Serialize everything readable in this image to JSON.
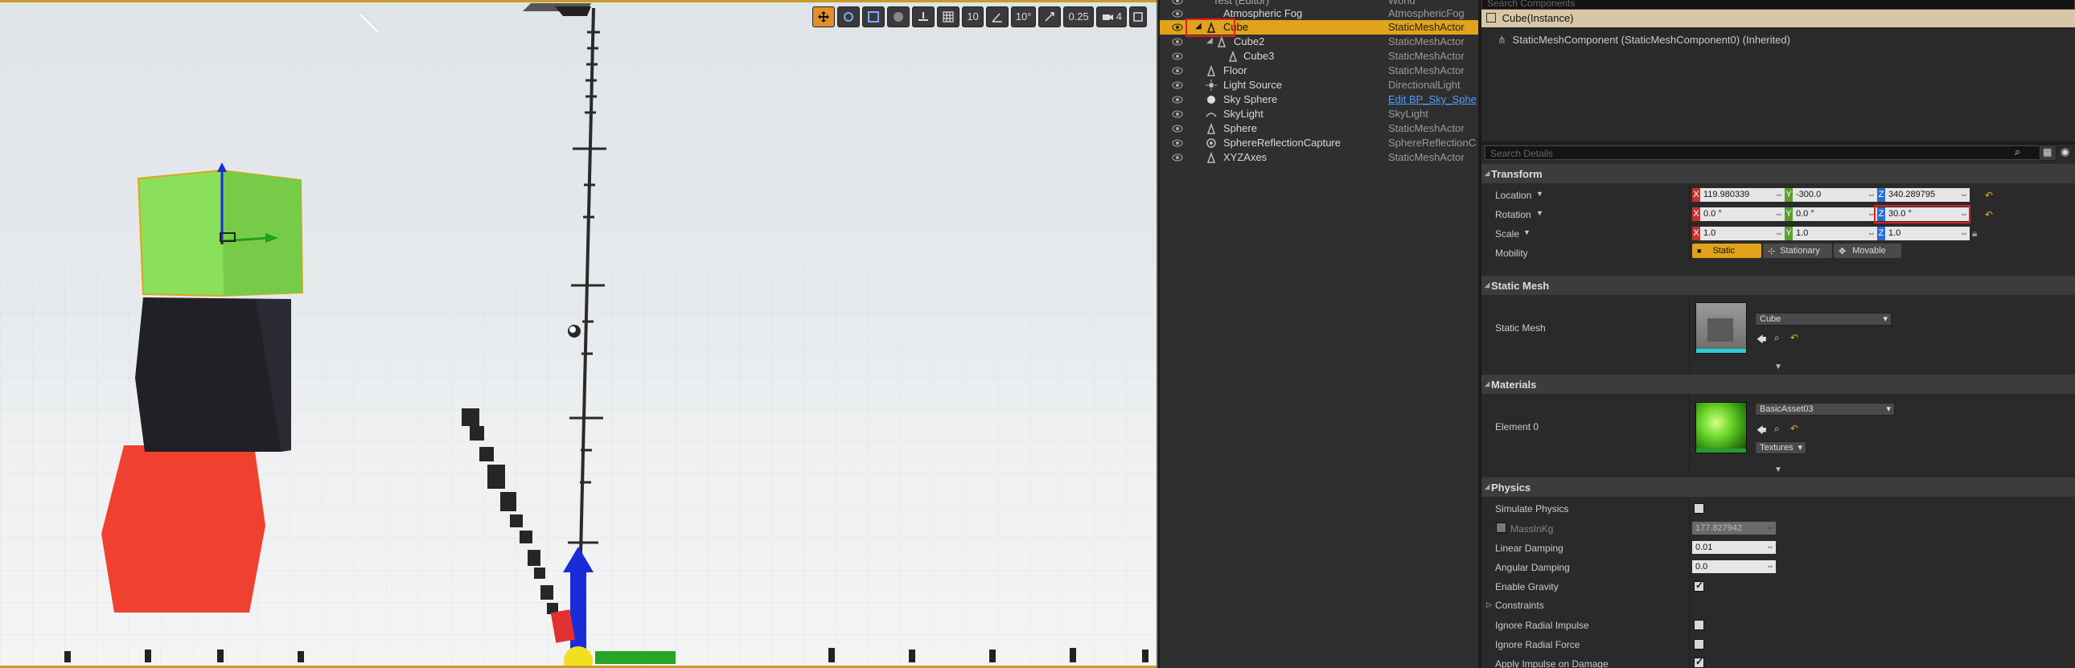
{
  "viewport": {
    "toolbar": {
      "grid_snap": "10",
      "rotation_snap": "10°",
      "scale_snap": "0.25",
      "camera_speed": "4"
    }
  },
  "outliner": {
    "rows": [
      {
        "name": "Test (Editor)",
        "type": "World"
      },
      {
        "name": "Atmospheric Fog",
        "type": "AtmosphericFog"
      },
      {
        "name": "Cube",
        "type": "StaticMeshActor"
      },
      {
        "name": "Cube2",
        "type": "StaticMeshActor"
      },
      {
        "name": "Cube3",
        "type": "StaticMeshActor"
      },
      {
        "name": "Floor",
        "type": "StaticMeshActor"
      },
      {
        "name": "Light Source",
        "type": "DirectionalLight"
      },
      {
        "name": "Sky Sphere",
        "type": "Edit BP_Sky_Sphere"
      },
      {
        "name": "SkyLight",
        "type": "SkyLight"
      },
      {
        "name": "Sphere",
        "type": "StaticMeshActor"
      },
      {
        "name": "SphereReflectionCapture",
        "type": "SphereReflectionCapture"
      },
      {
        "name": "XYZAxes",
        "type": "StaticMeshActor"
      }
    ]
  },
  "details": {
    "components_search_placeholder": "Search Components",
    "selected_component": "Cube(Instance)",
    "component_child": "StaticMeshComponent (StaticMeshComponent0) (Inherited)",
    "details_search_placeholder": "Search Details",
    "transform": {
      "title": "Transform",
      "location_label": "Location",
      "rotation_label": "Rotation",
      "scale_label": "Scale",
      "mobility_label": "Mobility",
      "location": {
        "x": "119.980339",
        "y": "-300.0",
        "z": "340.289795"
      },
      "rotation": {
        "x": "0.0 °",
        "y": "0.0 °",
        "z": "30.0 °"
      },
      "scale": {
        "x": "1.0",
        "y": "1.0",
        "z": "1.0"
      },
      "mobility": {
        "static": "Static",
        "stationary": "Stationary",
        "movable": "Movable"
      }
    },
    "static_mesh": {
      "title": "Static Mesh",
      "label": "Static Mesh",
      "value": "Cube"
    },
    "materials": {
      "title": "Materials",
      "label": "Element 0",
      "value": "BasicAsset03",
      "textures_button": "Textures"
    },
    "physics": {
      "title": "Physics",
      "simulate_physics": "Simulate Physics",
      "mass_label": "MassInKg",
      "mass_value": "177.827942",
      "linear_damping": "Linear Damping",
      "linear_damping_value": "0.01",
      "angular_damping": "Angular Damping",
      "angular_damping_value": "0.0",
      "enable_gravity": "Enable Gravity",
      "constraints": "Constraints",
      "ignore_radial_impulse": "Ignore Radial Impulse",
      "ignore_radial_force": "Ignore Radial Force",
      "apply_impulse_on_damage": "Apply Impulse on Damage"
    }
  },
  "colors": {
    "selection": "#e0a31a",
    "highlight_box": "#e02020",
    "axis_x": "#c43232",
    "axis_y": "#5ca02c",
    "axis_z": "#2d6cd4"
  }
}
